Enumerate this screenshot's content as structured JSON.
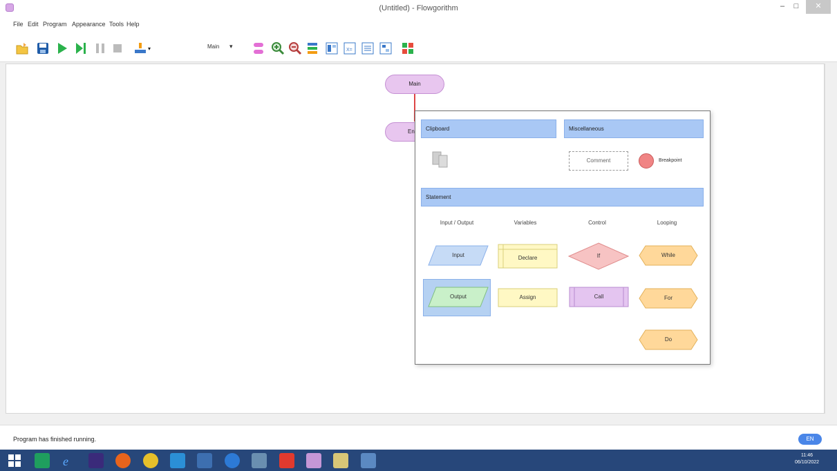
{
  "window": {
    "title": "(Untitled) - Flowgorithm",
    "minimize": "–",
    "maximize": "□",
    "close": "✕"
  },
  "menu": [
    "File",
    "Edit",
    "Program",
    "Appearance",
    "Tools",
    "Help"
  ],
  "toolbar": {
    "function_select": "Main",
    "icons": [
      "open-icon",
      "save-icon",
      "run-icon",
      "step-icon",
      "pause-icon",
      "stop-icon",
      "output-icon",
      "function-manager-icon",
      "zoom-in-icon",
      "zoom-out-icon",
      "layout-icon",
      "console-icon",
      "variable-watch-icon",
      "source-code-icon",
      "flowchart-view-icon",
      "generate-code-icon"
    ]
  },
  "flowchart": {
    "main_label": "Main",
    "end_label": "End"
  },
  "insert_popup": {
    "clipboard_header": "Clipboard",
    "misc_header": "Miscellaneous",
    "comment_label": "Comment",
    "breakpoint_label": "Breakpoint",
    "statement_header": "Statement",
    "columns": [
      "Input / Output",
      "Variables",
      "Control",
      "Looping"
    ],
    "shapes": {
      "input": "Input",
      "output": "Output",
      "declare": "Declare",
      "assign": "Assign",
      "if": "If",
      "call": "Call",
      "while": "While",
      "for": "For",
      "do": "Do"
    }
  },
  "status": {
    "text": "Program has finished running.",
    "language": "EN"
  },
  "taskbar": {
    "time": "11:46",
    "date": "06/10/2022"
  },
  "colors": {
    "terminal": "#e8c6ef",
    "io": "#c6dbf6",
    "process": "#fff8c4",
    "control": "#f7c3c3",
    "loop": "#ffd89a",
    "header": "#a9c8f5"
  }
}
